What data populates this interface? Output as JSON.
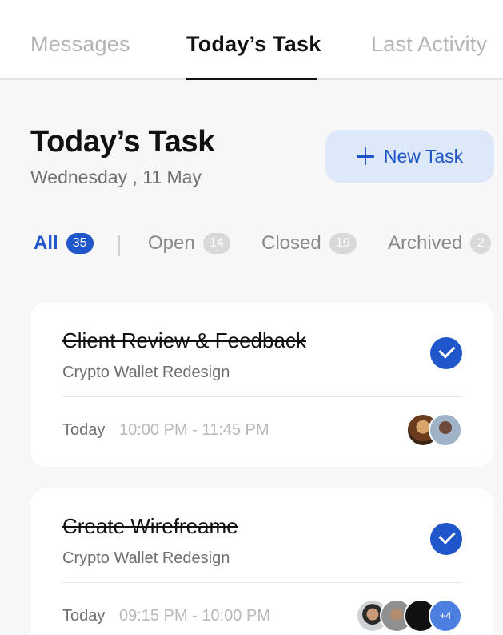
{
  "tabs": {
    "messages": "Messages",
    "today": "Today’s Task",
    "last_activity": "Last Activity"
  },
  "header": {
    "title": "Today’s Task",
    "date": "Wednesday , 11 May",
    "new_task_label": "New Task"
  },
  "filters": [
    {
      "label": "All",
      "count": "35"
    },
    {
      "label": "Open",
      "count": "14"
    },
    {
      "label": "Closed",
      "count": "19"
    },
    {
      "label": "Archived",
      "count": "2"
    }
  ],
  "tasks": [
    {
      "title": "Client Review & Feedback",
      "subtitle": "Crypto Wallet Redesign",
      "day": "Today",
      "time": "10:00 PM - 11:45 PM",
      "completed": true
    },
    {
      "title": "Create Wirefreame",
      "subtitle": "Crypto Wallet Redesign",
      "day": "Today",
      "time": "09:15 PM - 10:00 PM",
      "completed": true,
      "more_members": "+4"
    }
  ],
  "colors": {
    "accent": "#1f56c9",
    "accent_light": "#dde9f8",
    "background": "#f7f7f7"
  }
}
